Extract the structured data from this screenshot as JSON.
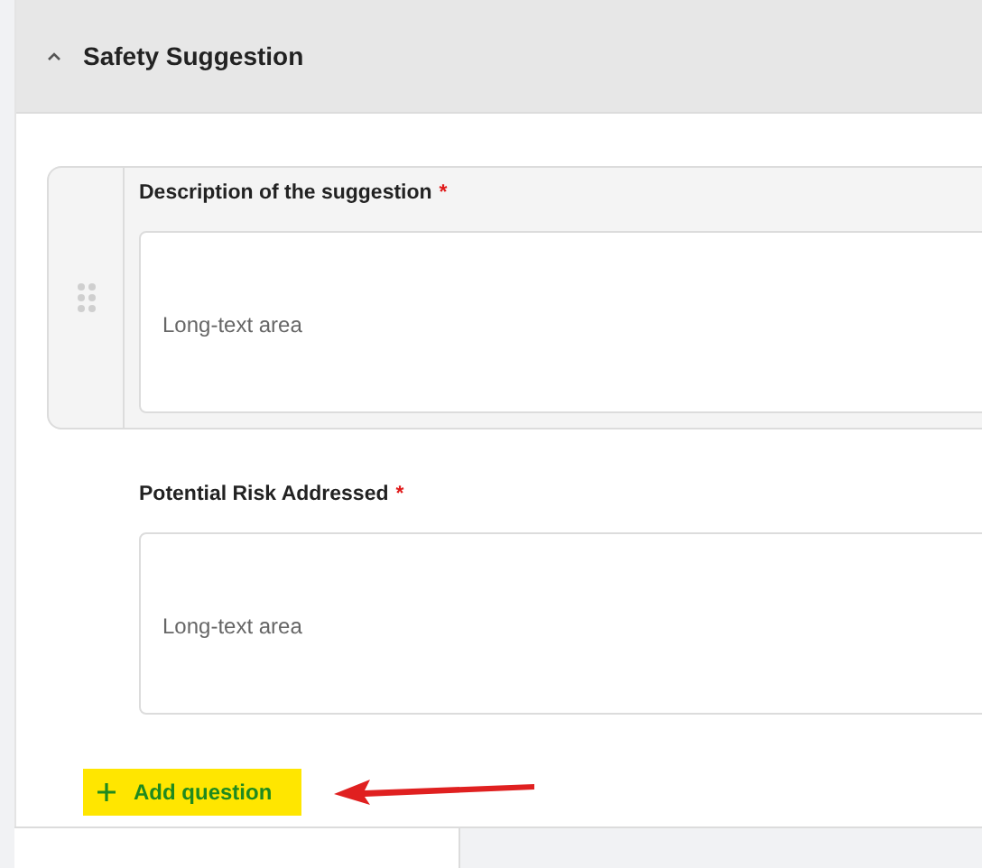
{
  "section": {
    "title": "Safety Suggestion",
    "expanded": true
  },
  "questions": [
    {
      "label": "Description of the suggestion",
      "required_mark": "*",
      "placeholder": "Long-text area",
      "selected": true
    },
    {
      "label": "Potential Risk Addressed",
      "required_mark": "*",
      "placeholder": "Long-text area",
      "selected": false
    }
  ],
  "add_button": {
    "label": "Add question",
    "highlighted": true
  }
}
